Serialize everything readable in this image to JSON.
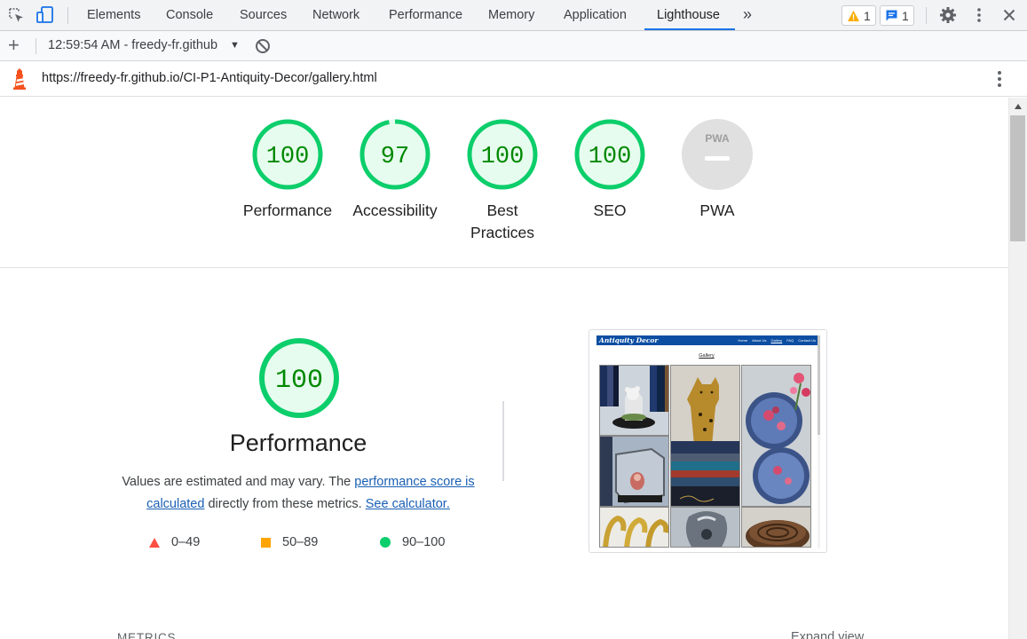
{
  "devtools": {
    "tabs": [
      "Elements",
      "Console",
      "Sources",
      "Network",
      "Performance",
      "Memory",
      "Application",
      "Lighthouse"
    ],
    "active_tab": "Lighthouse",
    "more_tabs_glyph": "»",
    "warnings_count": "1",
    "messages_count": "1",
    "icons": [
      "inspect-element-icon",
      "device-toolbar-icon",
      "settings-gear-icon",
      "kebab-menu-icon",
      "close-icon"
    ]
  },
  "report_toolbar": {
    "add_glyph": "+",
    "report_selector": "12:59:54 AM - freedy-fr.github",
    "dropdown_glyph": "▼"
  },
  "url_bar": {
    "url": "https://freedy-fr.github.io/CI-P1-Antiquity-Decor/gallery.html"
  },
  "gauges": [
    {
      "label_lines": [
        "Performance"
      ],
      "score": "100",
      "value": 100,
      "color": "#0cce6b"
    },
    {
      "label_lines": [
        "Accessibility"
      ],
      "score": "97",
      "value": 97,
      "color": "#0cce6b"
    },
    {
      "label_lines": [
        "Best",
        "Practices"
      ],
      "score": "100",
      "value": 100,
      "color": "#0cce6b"
    },
    {
      "label_lines": [
        "SEO"
      ],
      "score": "100",
      "value": 100,
      "color": "#0cce6b"
    },
    {
      "label_lines": [
        "PWA"
      ],
      "score": "",
      "value": null,
      "color": "#9e9e9e",
      "badge_text": "PWA"
    }
  ],
  "performance": {
    "score": "100",
    "value": 100,
    "title": "Performance",
    "desc_prefix": "Values are estimated and may vary. The ",
    "desc_link1": "performance score is calculated",
    "desc_middle": " directly from these metrics. ",
    "desc_link2": "See calculator.",
    "legend": [
      {
        "range": "0–49",
        "color": "#ff4e42",
        "shape": "triangle"
      },
      {
        "range": "50–89",
        "color": "#ffa400",
        "shape": "square"
      },
      {
        "range": "90–100",
        "color": "#0cce6b",
        "shape": "circle"
      }
    ]
  },
  "thumbnail": {
    "site_name": "Antiquity Decor",
    "nav_links": [
      "Home",
      "About Us",
      "Gallery",
      "FAQ",
      "Contact Us"
    ],
    "heading": "Gallery"
  },
  "metrics": {
    "label": "METRICS",
    "expand_label": "Expand view"
  },
  "colors": {
    "pass": "#0cce6b",
    "pass_fill": "#e6fcee",
    "pass_text": "#008800",
    "accent": "#1a73e8"
  }
}
